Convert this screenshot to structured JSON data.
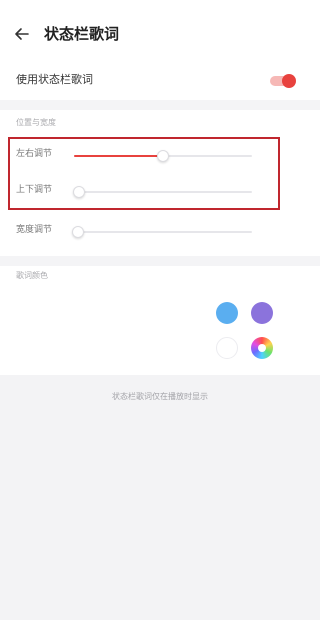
{
  "header": {
    "title": "状态栏歌词"
  },
  "toggle_row": {
    "label": "使用状态栏歌词",
    "enabled": true,
    "accent_color": "#e8423e"
  },
  "position_section": {
    "title": "位置与宽度"
  },
  "sliders": {
    "horizontal": {
      "label": "左右调节",
      "value": 0.5
    },
    "vertical": {
      "label": "上下调节",
      "value": 0.03
    },
    "width": {
      "label": "宽度调节",
      "value": 0.02
    }
  },
  "color_section": {
    "title": "歌词颜色"
  },
  "colors": {
    "blue": "#5aaef0",
    "purple": "#8b73dc",
    "white": "#ffffff",
    "custom": "color-wheel-icon"
  },
  "preview": {
    "text": "状态栏歌词仅在播放时显示"
  }
}
